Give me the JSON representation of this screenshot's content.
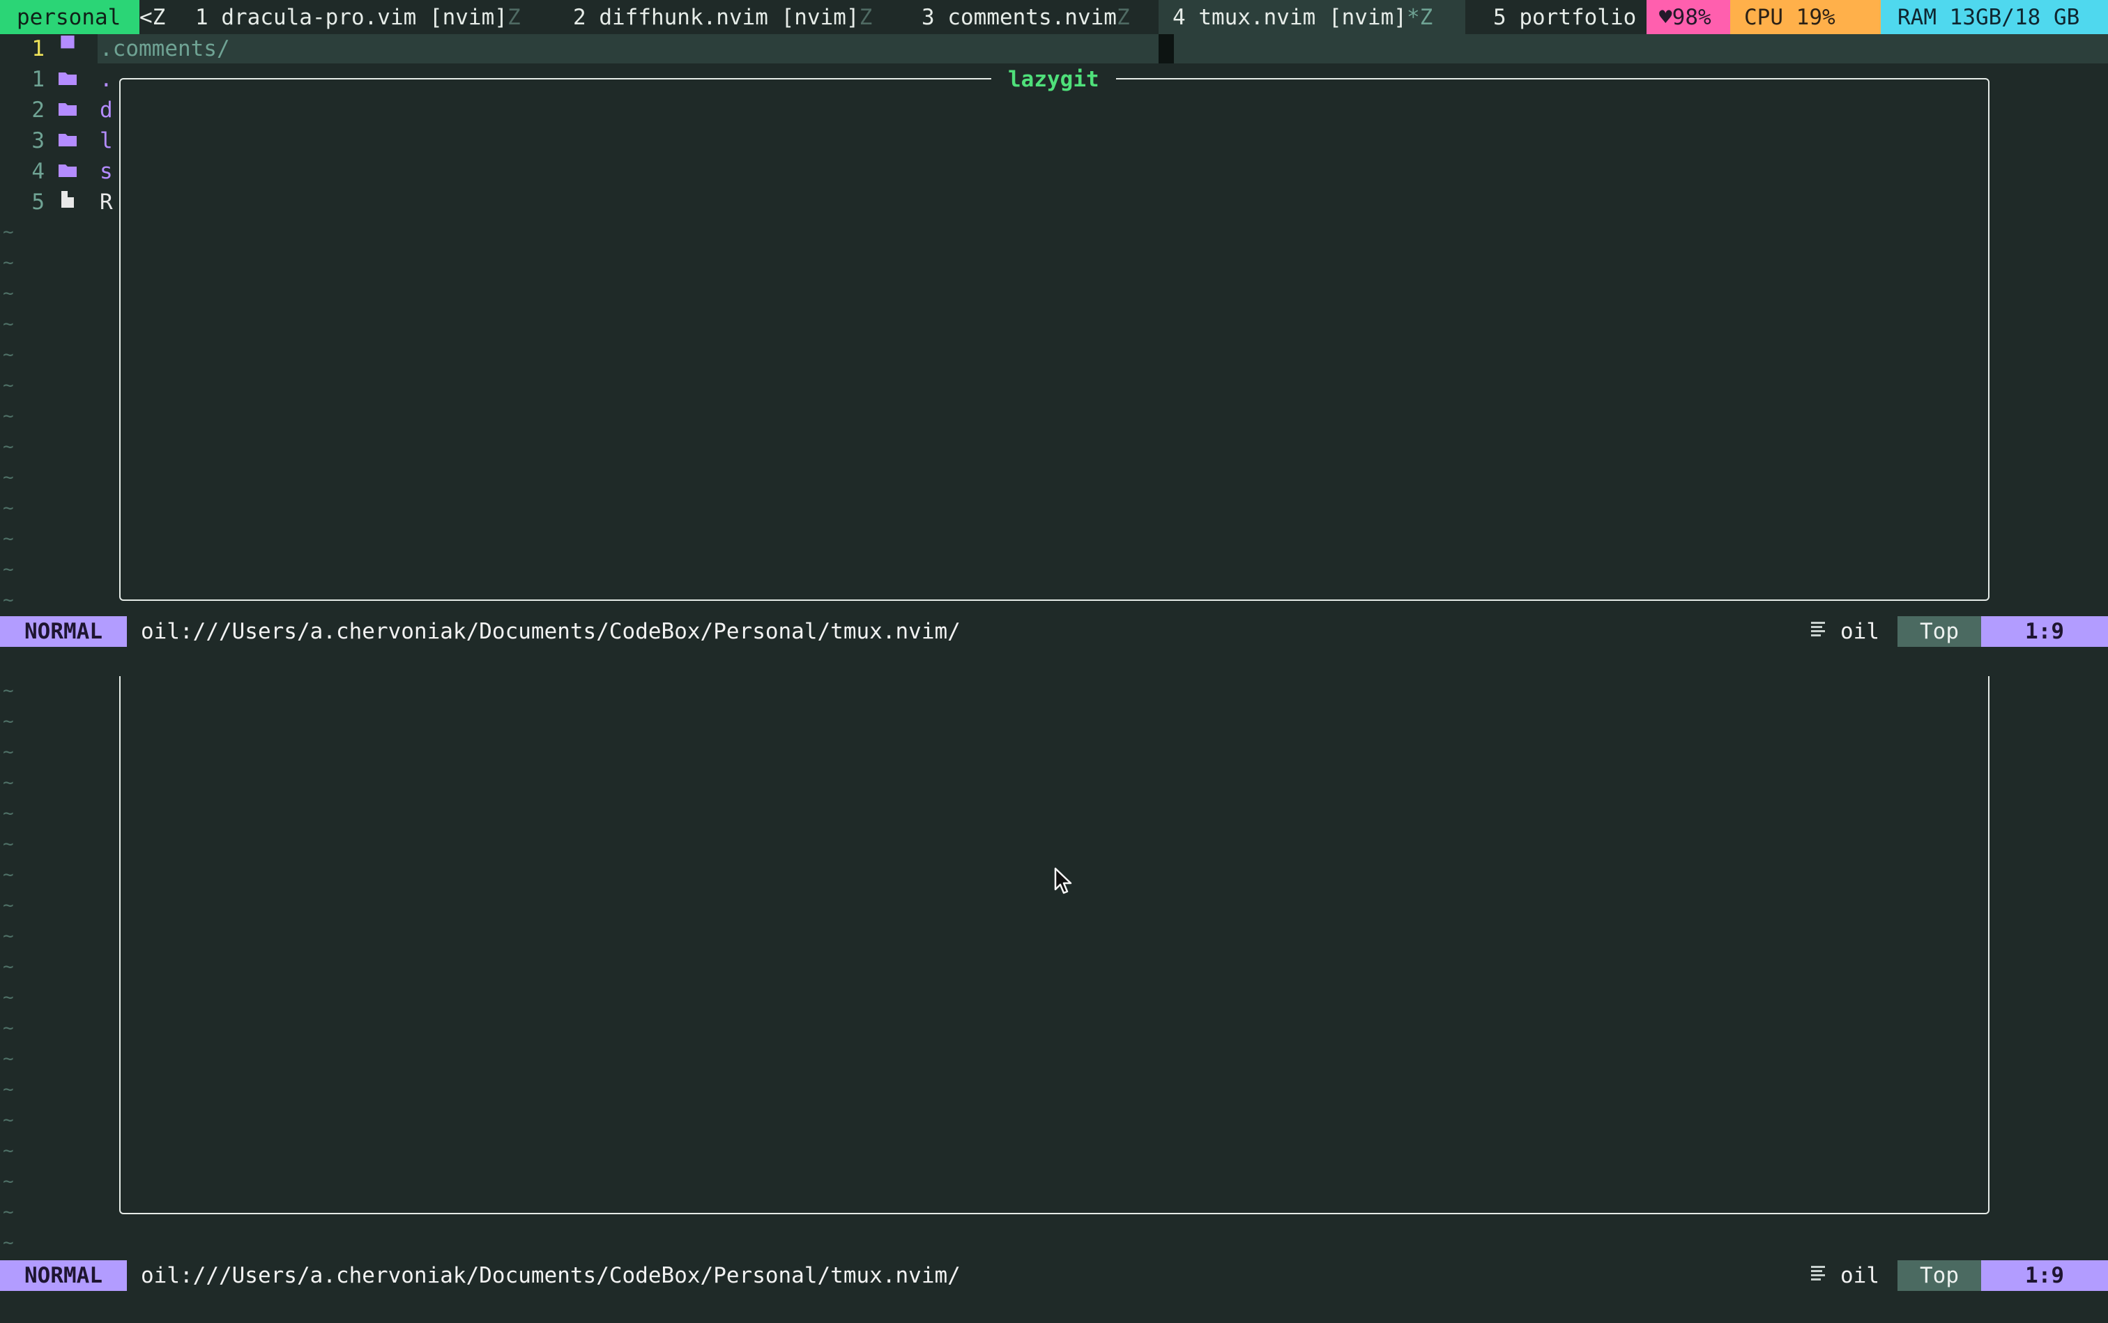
{
  "tmux": {
    "session": "personal",
    "session_marker": "<Z",
    "windows": [
      {
        "label": "1 dracula-pro.vim [nvim]",
        "flag": "Z"
      },
      {
        "label": "2 diffhunk.nvim [nvim]",
        "flag": "Z"
      },
      {
        "label": "3 comments.nvim",
        "flag": "Z"
      },
      {
        "label": "4 tmux.nvim [nvim]",
        "flag": "*Z"
      },
      {
        "label": "5 portfolio",
        "flag": ""
      }
    ],
    "battery": "♥98%",
    "cpu": "CPU  19%",
    "ram": "RAM 13GB/18 GB"
  },
  "oil": {
    "header_num": "1",
    "header_path": ".comments/",
    "entries": [
      {
        "num": "1",
        "icon": "folder",
        "name": "."
      },
      {
        "num": "2",
        "icon": "folder",
        "name": "d"
      },
      {
        "num": "3",
        "icon": "folder",
        "name": "l"
      },
      {
        "num": "4",
        "icon": "folder",
        "name": "s"
      },
      {
        "num": "5",
        "icon": "file",
        "name": "R"
      }
    ],
    "tilde": "~"
  },
  "float": {
    "title": "lazygit"
  },
  "statusline_top": {
    "mode": "NORMAL",
    "path": "oil:///Users/a.chervoniak/Documents/CodeBox/Personal/tmux.nvim/",
    "filetype": "oil",
    "position": "Top",
    "line_col": "1:9"
  },
  "statusline_bottom": {
    "mode": "NORMAL",
    "path": "oil:///Users/a.chervoniak/Documents/CodeBox/Personal/tmux.nvim/",
    "filetype": "oil",
    "position": "Top",
    "line_col": "1:9"
  },
  "colors": {
    "background": "#1f2a28",
    "session": "#2bd576",
    "battery": "#ff5fae",
    "cpu": "#ffb04a",
    "ram": "#4fd8ee",
    "mode": "#b29cff",
    "float_title": "#4fe07a"
  }
}
